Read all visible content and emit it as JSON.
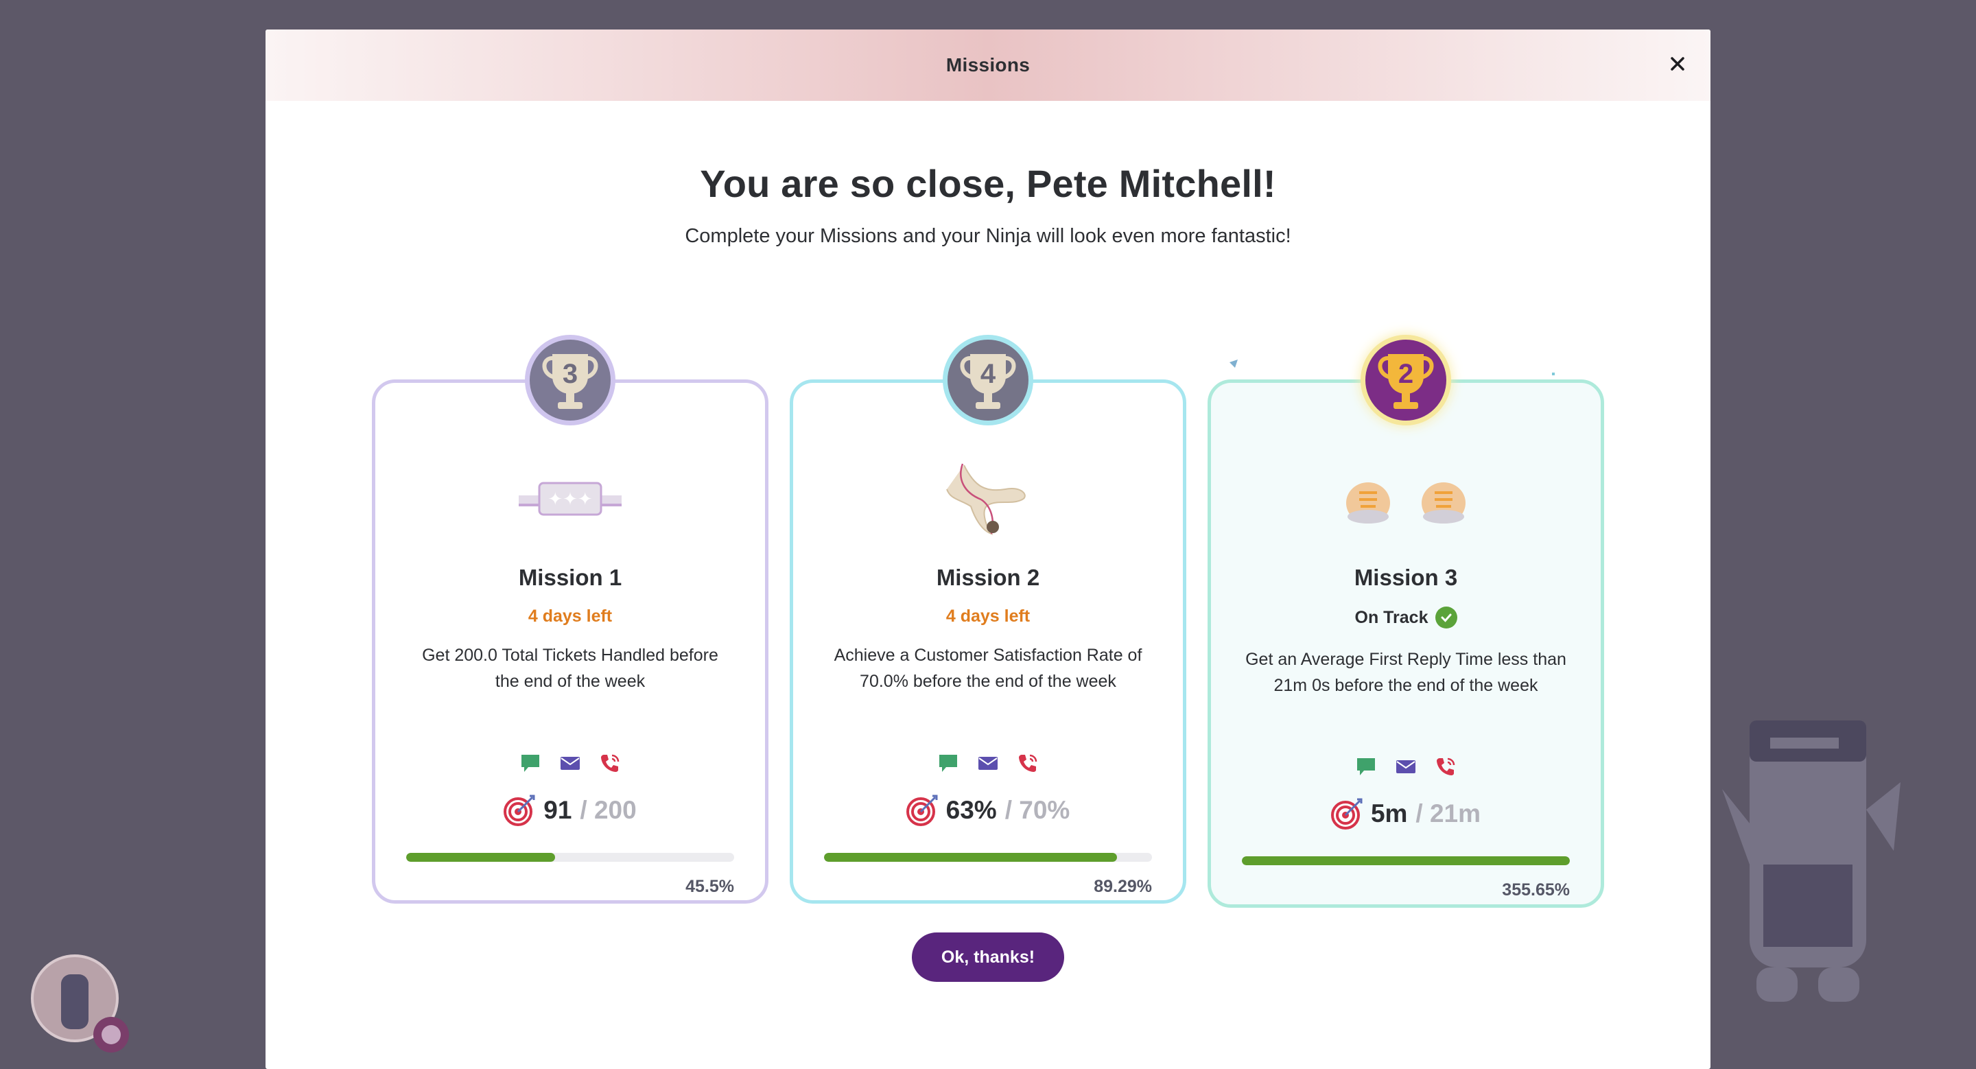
{
  "modal": {
    "title": "Missions",
    "headline": "You are so close, Pete Mitchell!",
    "subline": "Complete your Missions and your Ninja will look even more fantastic!",
    "ok_button": "Ok, thanks!"
  },
  "missions": [
    {
      "badge": "3",
      "title": "Mission 1",
      "status": "4 days left",
      "description": "Get 200.0 Total Tickets Handled before the end of the week",
      "current": "91",
      "goal": "/ 200",
      "progress_percent": "45.5%",
      "progress_value": 0.455,
      "art_icon": "stars-wristband-icon"
    },
    {
      "badge": "4",
      "title": "Mission 2",
      "status": "4 days left",
      "description": "Achieve a Customer Satisfaction Rate of 70.0% before the end of the week",
      "current": "63%",
      "goal": "/ 70%",
      "progress_percent": "89.29%",
      "progress_value": 0.8929,
      "art_icon": "slingshot-icon"
    },
    {
      "badge": "2",
      "title": "Mission 3",
      "status": "On Track",
      "description": "Get an Average First Reply Time less than 21m 0s before the end of the week",
      "current": "5m",
      "goal": "/ 21m",
      "progress_percent": "355.65%",
      "progress_value": 1.0,
      "art_icon": "ninja-shoes-icon"
    }
  ],
  "colors": {
    "accent": "#59257d",
    "progress": "#5e9e2c",
    "days_left": "#e07d1e",
    "chat": "#3fa26b",
    "email": "#5c4fae",
    "phone": "#d6334a"
  }
}
